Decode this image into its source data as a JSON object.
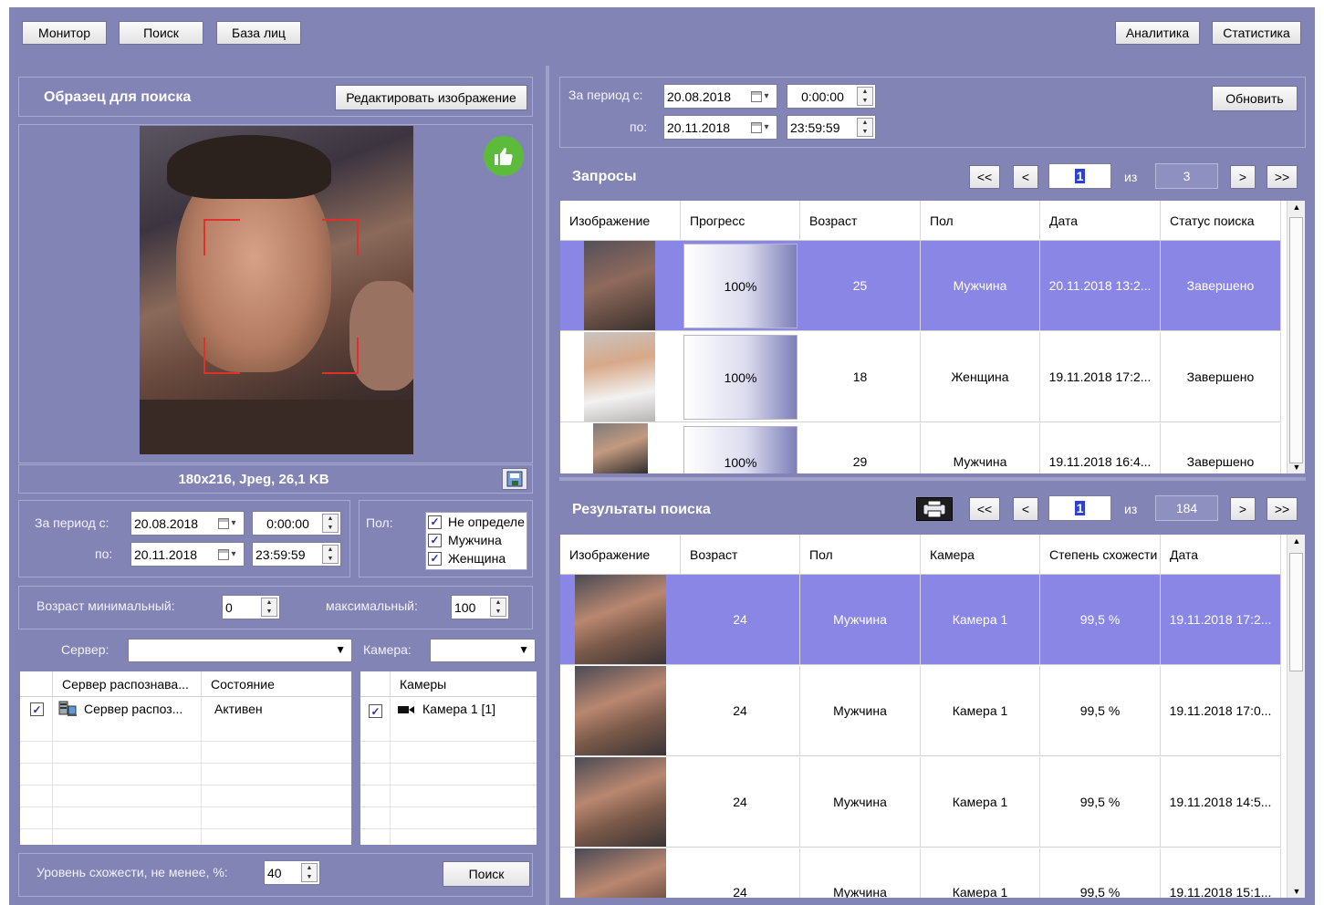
{
  "toolbar": {
    "monitor": "Монитор",
    "search": "Поиск",
    "face_db": "База лиц",
    "analytics": "Аналитика",
    "statistics": "Статистика"
  },
  "sample": {
    "title": "Образец для поиска",
    "edit_button": "Редактировать изображение",
    "image_info": "180x216, Jpeg, 26,1 KB"
  },
  "filters": {
    "period_from_label": "За период с:",
    "period_to_label": "по:",
    "date_from": "20.08.2018",
    "time_from": "0:00:00",
    "date_to": "20.11.2018",
    "time_to": "23:59:59",
    "gender_label": "Пол:",
    "gender_options": [
      "Не определе",
      "Мужчина",
      "Женщина"
    ],
    "age_min_label": "Возраст минимальный:",
    "age_min": "0",
    "age_max_label": "максимальный:",
    "age_max": "100",
    "server_label": "Сервер:",
    "server_value": "",
    "camera_label": "Камера:",
    "camera_value": "",
    "similarity_label": "Уровень схожести, не менее, %:",
    "similarity": "40",
    "search_button": "Поиск"
  },
  "servers_table": {
    "headers": [
      "Сервер распознава...",
      "Состояние"
    ],
    "rows": [
      {
        "name": "Сервер распоз...",
        "status": "Активен"
      }
    ]
  },
  "cameras_table": {
    "header": "Камеры",
    "rows": [
      {
        "name": "Камера 1 [1]"
      }
    ]
  },
  "right_period": {
    "label_from": "За период с:",
    "label_to": "по:",
    "date_from": "20.08.2018",
    "time_from": "0:00:00",
    "date_to": "20.11.2018",
    "time_to": "23:59:59",
    "refresh_button": "Обновить"
  },
  "requests": {
    "title": "Запросы",
    "pager": {
      "first": "<<",
      "prev": "<",
      "page": "1",
      "of": "из",
      "total": "3",
      "next": ">",
      "last": ">>"
    },
    "headers": [
      "Изображение",
      "Прогресс",
      "Возраст",
      "Пол",
      "Дата",
      "Статус поиска"
    ],
    "rows": [
      {
        "progress": "100%",
        "age": "25",
        "gender": "Мужчина",
        "date": "20.11.2018 13:2...",
        "status": "Завершено"
      },
      {
        "progress": "100%",
        "age": "18",
        "gender": "Женщина",
        "date": "19.11.2018 17:2...",
        "status": "Завершено"
      },
      {
        "progress": "100%",
        "age": "29",
        "gender": "Мужчина",
        "date": "19.11.2018 16:4...",
        "status": "Завершено"
      }
    ]
  },
  "results": {
    "title": "Результаты поиска",
    "pager": {
      "first": "<<",
      "prev": "<",
      "page": "1",
      "of": "из",
      "total": "184",
      "next": ">",
      "last": ">>"
    },
    "headers": [
      "Изображение",
      "Возраст",
      "Пол",
      "Камера",
      "Степень схожести",
      "Дата"
    ],
    "rows": [
      {
        "age": "24",
        "gender": "Мужчина",
        "camera": "Камера 1",
        "similarity": "99,5 %",
        "date": "19.11.2018 17:2..."
      },
      {
        "age": "24",
        "gender": "Мужчина",
        "camera": "Камера 1",
        "similarity": "99,5 %",
        "date": "19.11.2018 17:0..."
      },
      {
        "age": "24",
        "gender": "Мужчина",
        "camera": "Камера 1",
        "similarity": "99,5 %",
        "date": "19.11.2018 14:5..."
      },
      {
        "age": "24",
        "gender": "Мужчина",
        "camera": "Камера 1",
        "similarity": "99,5 %",
        "date": "19.11.2018 15:1..."
      }
    ]
  },
  "colors": {
    "background": "#8284b5",
    "selected_row": "#8a86e6",
    "accept_badge": "#5dbb3b",
    "face_frame": "#e0302b"
  }
}
